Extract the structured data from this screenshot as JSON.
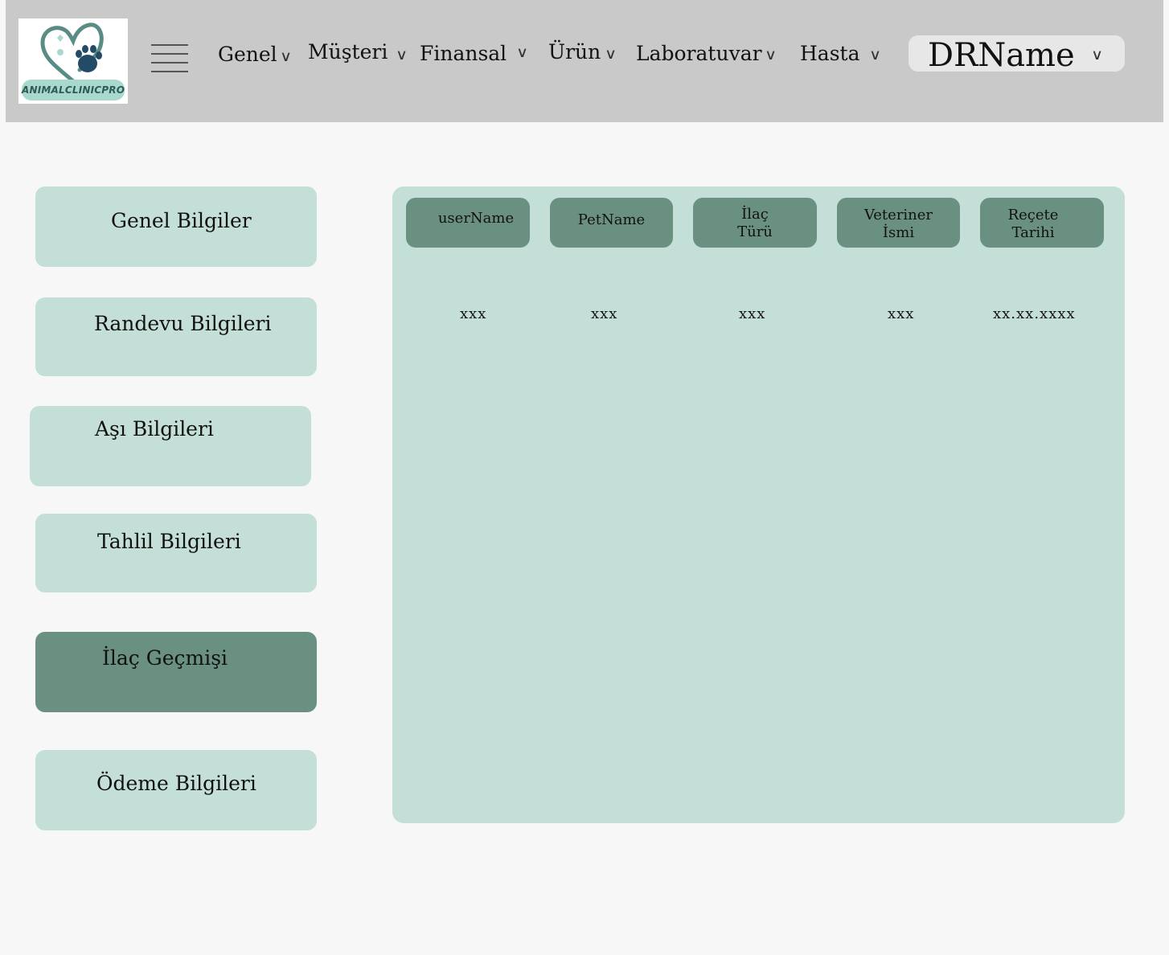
{
  "app": {
    "logo_text": "ANIMALCLINICPRO"
  },
  "nav": {
    "items": [
      {
        "label": "Genel",
        "chevron": "∨"
      },
      {
        "label": "Müşteri",
        "chevron": "∨"
      },
      {
        "label": "Finansal",
        "chevron": "∨"
      },
      {
        "label": "Ürün",
        "chevron": "∨"
      },
      {
        "label": "Laboratuvar",
        "chevron": "∨"
      },
      {
        "label": "Hasta",
        "chevron": "∨"
      }
    ],
    "user": {
      "name": "DRName",
      "chevron": "∨"
    }
  },
  "sidebar": {
    "items": [
      {
        "label": "Genel Bilgiler",
        "active": false
      },
      {
        "label": "Randevu Bilgileri",
        "active": false
      },
      {
        "label": "Aşı Bilgileri",
        "active": false
      },
      {
        "label": "Tahlil Bilgileri",
        "active": false
      },
      {
        "label": "İlaç Geçmişi",
        "active": true
      },
      {
        "label": "Ödeme Bilgileri",
        "active": false
      }
    ]
  },
  "table": {
    "columns": [
      {
        "line1": "userName",
        "line2": ""
      },
      {
        "line1": "PetName",
        "line2": ""
      },
      {
        "line1": "İlaç",
        "line2": "Türü"
      },
      {
        "line1": "Veteriner",
        "line2": "İsmi"
      },
      {
        "line1": "Reçete",
        "line2": "Tarihi"
      }
    ],
    "rows": [
      [
        "xxx",
        "xxx",
        "xxx",
        "xxx",
        "xx.xx.xxxx"
      ]
    ]
  },
  "colors": {
    "topbar": "#c9c9c9",
    "panel": "#c4dfd7",
    "accent": "#6a9082",
    "background": "#f7f7f7"
  }
}
